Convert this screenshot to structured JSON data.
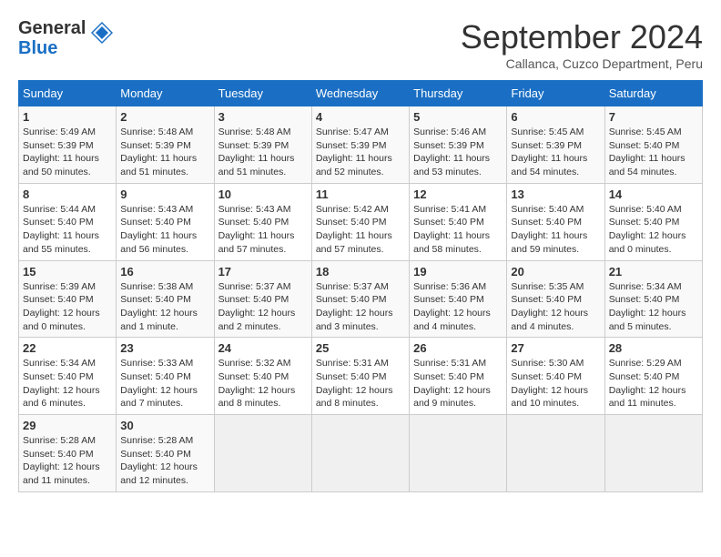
{
  "header": {
    "logo_general": "General",
    "logo_blue": "Blue",
    "month_title": "September 2024",
    "subtitle": "Callanca, Cuzco Department, Peru"
  },
  "weekdays": [
    "Sunday",
    "Monday",
    "Tuesday",
    "Wednesday",
    "Thursday",
    "Friday",
    "Saturday"
  ],
  "weeks": [
    [
      {
        "day": "1",
        "info": "Sunrise: 5:49 AM\nSunset: 5:39 PM\nDaylight: 11 hours\nand 50 minutes."
      },
      {
        "day": "2",
        "info": "Sunrise: 5:48 AM\nSunset: 5:39 PM\nDaylight: 11 hours\nand 51 minutes."
      },
      {
        "day": "3",
        "info": "Sunrise: 5:48 AM\nSunset: 5:39 PM\nDaylight: 11 hours\nand 51 minutes."
      },
      {
        "day": "4",
        "info": "Sunrise: 5:47 AM\nSunset: 5:39 PM\nDaylight: 11 hours\nand 52 minutes."
      },
      {
        "day": "5",
        "info": "Sunrise: 5:46 AM\nSunset: 5:39 PM\nDaylight: 11 hours\nand 53 minutes."
      },
      {
        "day": "6",
        "info": "Sunrise: 5:45 AM\nSunset: 5:39 PM\nDaylight: 11 hours\nand 54 minutes."
      },
      {
        "day": "7",
        "info": "Sunrise: 5:45 AM\nSunset: 5:40 PM\nDaylight: 11 hours\nand 54 minutes."
      }
    ],
    [
      {
        "day": "8",
        "info": "Sunrise: 5:44 AM\nSunset: 5:40 PM\nDaylight: 11 hours\nand 55 minutes."
      },
      {
        "day": "9",
        "info": "Sunrise: 5:43 AM\nSunset: 5:40 PM\nDaylight: 11 hours\nand 56 minutes."
      },
      {
        "day": "10",
        "info": "Sunrise: 5:43 AM\nSunset: 5:40 PM\nDaylight: 11 hours\nand 57 minutes."
      },
      {
        "day": "11",
        "info": "Sunrise: 5:42 AM\nSunset: 5:40 PM\nDaylight: 11 hours\nand 57 minutes."
      },
      {
        "day": "12",
        "info": "Sunrise: 5:41 AM\nSunset: 5:40 PM\nDaylight: 11 hours\nand 58 minutes."
      },
      {
        "day": "13",
        "info": "Sunrise: 5:40 AM\nSunset: 5:40 PM\nDaylight: 11 hours\nand 59 minutes."
      },
      {
        "day": "14",
        "info": "Sunrise: 5:40 AM\nSunset: 5:40 PM\nDaylight: 12 hours\nand 0 minutes."
      }
    ],
    [
      {
        "day": "15",
        "info": "Sunrise: 5:39 AM\nSunset: 5:40 PM\nDaylight: 12 hours\nand 0 minutes."
      },
      {
        "day": "16",
        "info": "Sunrise: 5:38 AM\nSunset: 5:40 PM\nDaylight: 12 hours\nand 1 minute."
      },
      {
        "day": "17",
        "info": "Sunrise: 5:37 AM\nSunset: 5:40 PM\nDaylight: 12 hours\nand 2 minutes."
      },
      {
        "day": "18",
        "info": "Sunrise: 5:37 AM\nSunset: 5:40 PM\nDaylight: 12 hours\nand 3 minutes."
      },
      {
        "day": "19",
        "info": "Sunrise: 5:36 AM\nSunset: 5:40 PM\nDaylight: 12 hours\nand 4 minutes."
      },
      {
        "day": "20",
        "info": "Sunrise: 5:35 AM\nSunset: 5:40 PM\nDaylight: 12 hours\nand 4 minutes."
      },
      {
        "day": "21",
        "info": "Sunrise: 5:34 AM\nSunset: 5:40 PM\nDaylight: 12 hours\nand 5 minutes."
      }
    ],
    [
      {
        "day": "22",
        "info": "Sunrise: 5:34 AM\nSunset: 5:40 PM\nDaylight: 12 hours\nand 6 minutes."
      },
      {
        "day": "23",
        "info": "Sunrise: 5:33 AM\nSunset: 5:40 PM\nDaylight: 12 hours\nand 7 minutes."
      },
      {
        "day": "24",
        "info": "Sunrise: 5:32 AM\nSunset: 5:40 PM\nDaylight: 12 hours\nand 8 minutes."
      },
      {
        "day": "25",
        "info": "Sunrise: 5:31 AM\nSunset: 5:40 PM\nDaylight: 12 hours\nand 8 minutes."
      },
      {
        "day": "26",
        "info": "Sunrise: 5:31 AM\nSunset: 5:40 PM\nDaylight: 12 hours\nand 9 minutes."
      },
      {
        "day": "27",
        "info": "Sunrise: 5:30 AM\nSunset: 5:40 PM\nDaylight: 12 hours\nand 10 minutes."
      },
      {
        "day": "28",
        "info": "Sunrise: 5:29 AM\nSunset: 5:40 PM\nDaylight: 12 hours\nand 11 minutes."
      }
    ],
    [
      {
        "day": "29",
        "info": "Sunrise: 5:28 AM\nSunset: 5:40 PM\nDaylight: 12 hours\nand 11 minutes."
      },
      {
        "day": "30",
        "info": "Sunrise: 5:28 AM\nSunset: 5:40 PM\nDaylight: 12 hours\nand 12 minutes."
      },
      {
        "day": "",
        "info": ""
      },
      {
        "day": "",
        "info": ""
      },
      {
        "day": "",
        "info": ""
      },
      {
        "day": "",
        "info": ""
      },
      {
        "day": "",
        "info": ""
      }
    ]
  ]
}
